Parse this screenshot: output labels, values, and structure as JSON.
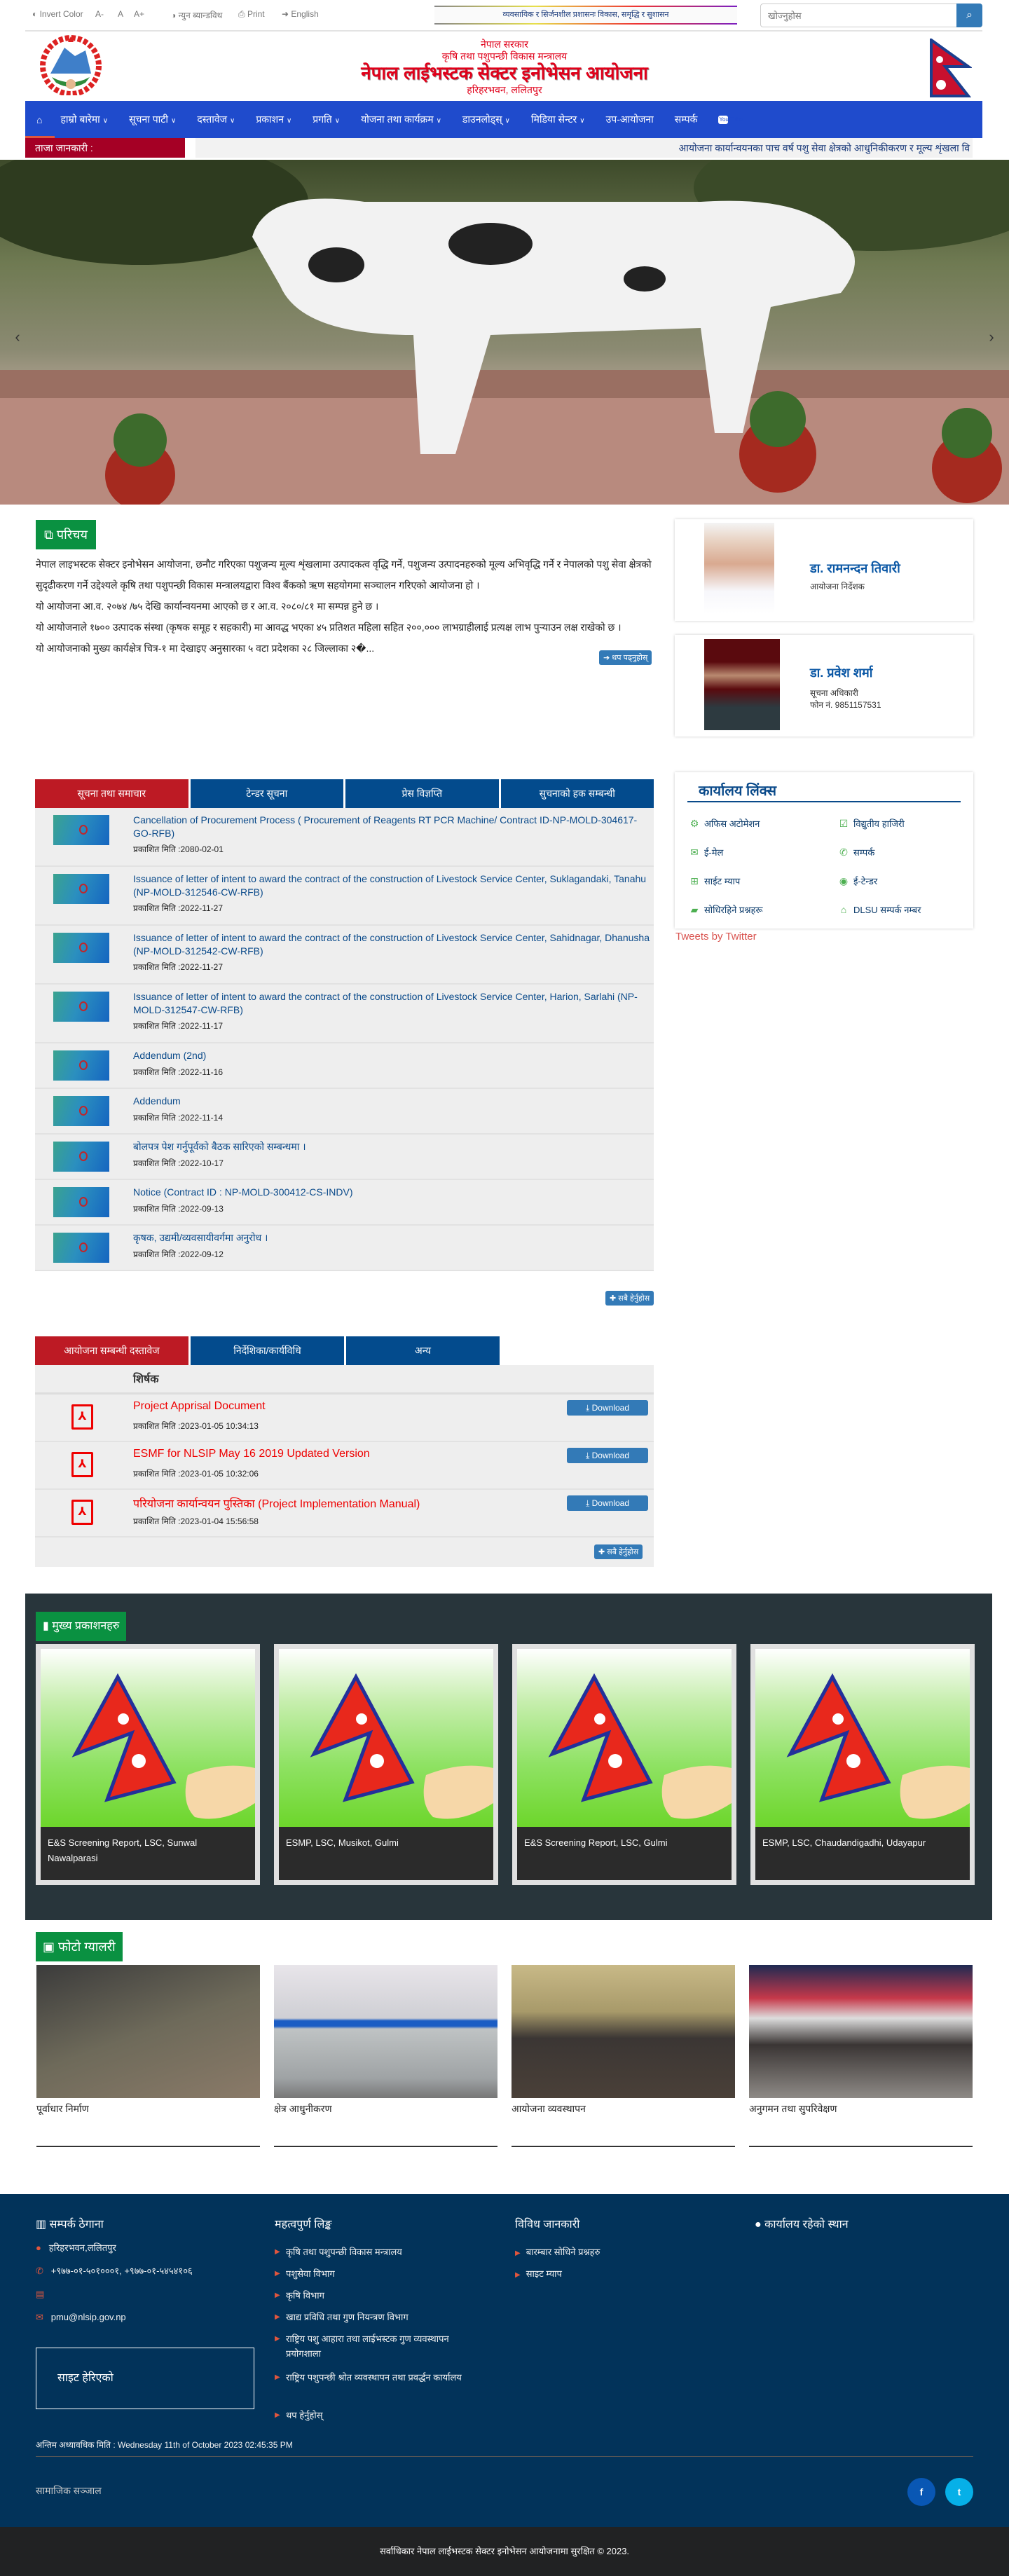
{
  "topbar": {
    "invert": "Invert Color",
    "font_minus": "A-",
    "font_normal": "A",
    "font_plus": "A+",
    "low_bandwidth": "न्युन ब्यान्डविथ",
    "print": "Print",
    "language": "English",
    "slogan": "व्यवसायिक र सिर्जनशील प्रशासनः विकास, समृद्धि र सुशासन",
    "search_placeholder": "खोज्नुहोस"
  },
  "header": {
    "line1": "नेपाल सरकार",
    "line2": "कृषि तथा पशुपन्छी विकास मन्त्रालय",
    "title": "नेपाल लाईभस्टक सेक्टर इनोभेसन आयोजना",
    "address": "हरिहरभवन, ललितपुर"
  },
  "nav": {
    "items": [
      {
        "label": "हाम्रो बारेमा",
        "dropdown": true
      },
      {
        "label": "सूचना पाटी",
        "dropdown": true
      },
      {
        "label": "दस्तावेज",
        "dropdown": true
      },
      {
        "label": "प्रकाशन",
        "dropdown": true
      },
      {
        "label": "प्रगति",
        "dropdown": true
      },
      {
        "label": "योजना तथा कार्यक्रम",
        "dropdown": true
      },
      {
        "label": "डाउनलोड्स्",
        "dropdown": true
      },
      {
        "label": "मिडिया सेन्टर",
        "dropdown": true
      },
      {
        "label": "उप-आयोजना",
        "dropdown": false
      },
      {
        "label": "सम्पर्क",
        "dropdown": false
      }
    ],
    "youtube": "You Tube"
  },
  "ticker": {
    "label": "ताजा जानकारी :",
    "text": "आयोजना कार्यान्वयनका पाच वर्ष पशु सेवा क्षेत्रको आधुनिकीकरण र मूल्य शृंखला वि"
  },
  "intro": {
    "heading": "परिचय",
    "paragraphs": [
      "नेपाल लाइभस्टक सेक्टर इनोभेसन आयोजना, छनौट गरिएका पशुजन्य मूल्य शृंखलामा उत्पादकत्व वृद्धि गर्ने, पशुजन्य उत्पादनहरुको मूल्य अभिवृद्धि गर्ने र नेपालको पशु सेवा क्षेत्रको सुदृढीकरण गर्ने उद्देश्यले कृषि तथा पशुपन्छी विकास मन्त्रालयद्वारा विश्व बैंकको ऋण सहयोगमा सञ्चालन गरिएको आयोजना हो ।",
      "यो आयोजना आ.व. २०७४ /७५ देखि कार्यान्वयनमा आएको छ र आ.व. २०८०/८१ मा सम्पन्न हुने छ ।",
      "यो आयोजनाले १७०० उत्पादक संस्था (कृषक समूह र सहकारी) मा आवद्ध भएका ४५ प्रतिशत महिला सहित २००,००० लाभग्राहीलाई प्रत्यक्ष लाभ पुर्‍याउन  लक्ष राखेको छ ।",
      "यो आयोजनाको मुख्य कार्यक्षेत्र चित्र-१ मा देखाइए अनुसारका ५ वटा प्रदेशका २८ जिल्लाका २�..."
    ],
    "read_more": "थप पढ्नुहोस्"
  },
  "officials": [
    {
      "name": "डा. रामनन्दन तिवारी",
      "role": "आयोजना निर्देशक",
      "phone": ""
    },
    {
      "name": "डा. प्रवेश शर्मा",
      "role": "सूचना अधिकारी",
      "phone": "फोन नं. 9851157531"
    }
  ],
  "notices": {
    "tabs": [
      "सूचना तथा समाचार",
      "टेन्डर सूचना",
      "प्रेस विज्ञप्ति",
      "सुचनाको हक सम्बन्धी"
    ],
    "date_label": "प्रकाशित मिति :",
    "items": [
      {
        "title": "Cancellation of Procurement Process ( Procurement of Reagents RT PCR Machine/ Contract ID-NP-MOLD-304617-GO-RFB)",
        "date": "2080-02-01"
      },
      {
        "title": "Issuance of letter of intent to award the contract of the construction of Livestock Service Center, Suklagandaki, Tanahu (NP-MOLD-312546-CW-RFB)",
        "date": "2022-11-27"
      },
      {
        "title": "Issuance of letter of intent to award the contract of the construction of Livestock Service Center, Sahidnagar, Dhanusha (NP-MOLD-312542-CW-RFB)",
        "date": "2022-11-27"
      },
      {
        "title": "Issuance of letter of intent to award the contract of the construction of Livestock Service Center, Harion, Sarlahi (NP-MOLD-312547-CW-RFB)",
        "date": "2022-11-17"
      },
      {
        "title": "Addendum (2nd)",
        "date": "2022-11-16"
      },
      {
        "title": "Addendum",
        "date": "2022-11-14"
      },
      {
        "title": "बोलपत्र पेश गर्नुपूर्वको बैठक सारिएको सम्बन्धमा ।",
        "date": "2022-10-17"
      },
      {
        "title": "Notice (Contract ID : NP-MOLD-300412-CS-INDV)",
        "date": "2022-09-13"
      },
      {
        "title": "कृषक, उद्यमी/व्यवसायीवर्गमा अनुरोध ।",
        "date": "2022-09-12"
      }
    ],
    "view_all": "सबै हेर्नुहोस"
  },
  "office_links": {
    "title": "कार्यालय लिंक्स",
    "items": [
      {
        "label": "अफिस अटोमेशन",
        "icon": "gears-icon"
      },
      {
        "label": "विद्युतीय हाजिरी",
        "icon": "calendar-check-icon"
      },
      {
        "label": "ई-मेल",
        "icon": "envelope-icon"
      },
      {
        "label": "सम्पर्क",
        "icon": "phone-icon"
      },
      {
        "label": "साईट म्याप",
        "icon": "sitemap-icon"
      },
      {
        "label": "ई-टेन्डर",
        "icon": "globe-icon"
      },
      {
        "label": "सोधिरहिने प्रश्नहरू",
        "icon": "book-icon"
      },
      {
        "label": "DLSU सम्पर्क नम्बर",
        "icon": "bank-icon"
      }
    ],
    "tweets": "Tweets by Twitter"
  },
  "documents": {
    "tabs": [
      "आयोजना सम्बन्धी दस्तावेज",
      "निर्देशिका/कार्यविधि",
      "अन्य"
    ],
    "column_header": "शिर्षक",
    "date_label": "प्रकाशित मिति :",
    "download_label": "Download",
    "items": [
      {
        "title": "Project Apprisal Document",
        "date": "2023-01-05 10:34:13"
      },
      {
        "title": "ESMF for NLSIP May 16 2019 Updated Version",
        "date": "2023-01-05 10:32:06"
      },
      {
        "title": "परियोजना कार्यान्वयन पुस्तिका (Project Implementation Manual)",
        "date": "2023-01-04 15:56:58"
      }
    ],
    "view_all": "सबै हेर्नुहोस"
  },
  "publications": {
    "heading": "मुख्य प्रकाशनहरु",
    "items": [
      "E&S Screening Report, LSC, Sunwal Nawalparasi",
      "ESMP, LSC, Musikot, Gulmi",
      "E&S Screening Report, LSC, Gulmi",
      "ESMP, LSC, Chaudandigadhi, Udayapur"
    ]
  },
  "gallery": {
    "heading": "फोटो ग्यालरी",
    "items": [
      "पूर्वाधार निर्माण",
      "क्षेत्र आधुनीकरण",
      "आयोजना व्यवस्थापन",
      "अनुगमन तथा सुपरिवेक्षण"
    ]
  },
  "footer": {
    "contact_heading": "सम्पर्क ठेगाना",
    "address": "हरिहरभवन,ललितपुर",
    "phone": "+९७७-०१-५०१०००१, +९७७-०१-५४५४१०६",
    "email": "pmu@nlsip.gov.np",
    "visitors_label": "साइट हेरिएको",
    "links_heading": "महत्वपुर्ण लिङ्क",
    "links": [
      "कृषि तथा पशुपन्छी विकास मन्त्रालय",
      "पशुसेवा विभाग",
      "कृषि विभाग",
      "खाद्य प्रविधि तथा गुण नियन्त्रण विभाग",
      "राष्ट्रिय पशु आहारा तथा लाईभस्टक गुण व्यवस्थापन प्रयोगशाला",
      "राष्ट्रिय पशुपन्छी श्रोत व्यवस्थापन तथा प्रवर्द्धन कार्यालय",
      "थप हेर्नुहोस्"
    ],
    "misc_heading": "विविध जानकारी",
    "misc": [
      "बारम्बार सोधिने प्रश्नहरु",
      "साइट म्याप"
    ],
    "location_heading": "कार्यालय रहेको स्थान",
    "last_updated": "अन्तिम अध्यावधिक मिति : Wednesday 11th of October 2023 02:45:35 PM",
    "social_label": "सामाजिक सञ्जाल",
    "copyright": "सर्वाधिकार नेपाल लाईभस्टक सेक्टर इनोभेसन आयोजनामा सुरक्षित © 2023."
  },
  "colors": {
    "nav": "#1f4bcc",
    "ticker_label": "#a50025",
    "active_tab": "#bd1a24",
    "tab": "#034b8d",
    "badge": "#0a9141",
    "footer": "#02335a",
    "link": "#0a4a8a"
  }
}
